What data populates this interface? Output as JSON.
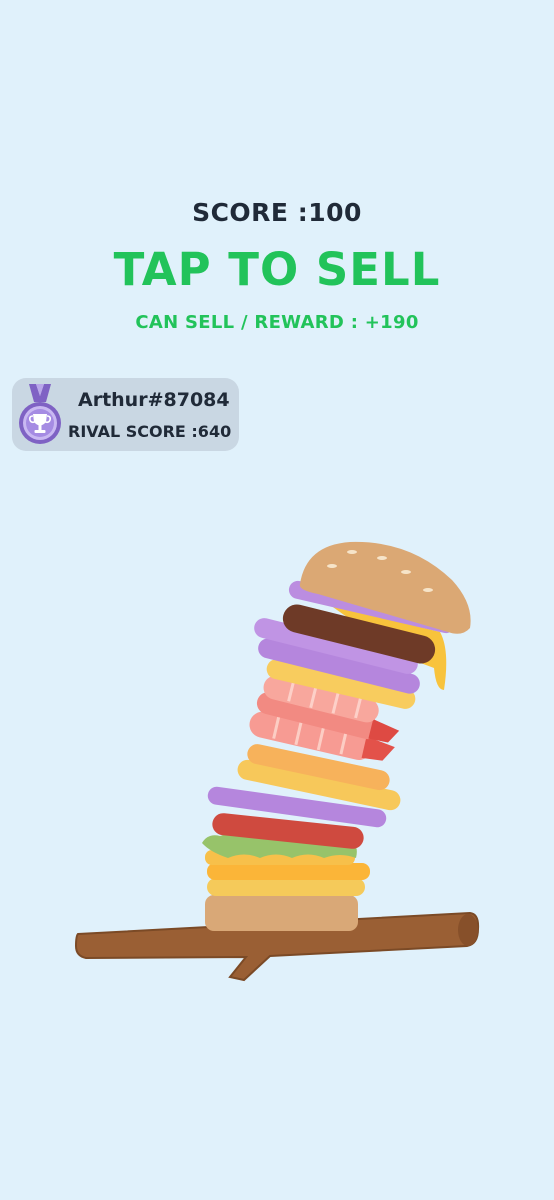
{
  "hud": {
    "score_label": "SCORE :100",
    "primary_action": "TAP TO SELL",
    "reward_label": "CAN SELL / REWARD : +190"
  },
  "rival": {
    "name": "Arthur#87084",
    "score_label": "RIVAL SCORE :640",
    "medal_icon": "trophy-medal-icon"
  },
  "colors": {
    "background": "#e0f1fb",
    "accent_green": "#22c35a",
    "text_dark": "#202a38",
    "card_bg": "#c9d7e3",
    "medal_purple": "#9a7fd6"
  },
  "burger_stack": {
    "layers_bottom_to_top": [
      "bottom-bun",
      "cheese",
      "cheese",
      "cheese",
      "lettuce",
      "bacon",
      "onion",
      "cheese",
      "cheese",
      "shrimp",
      "shrimp",
      "shrimp",
      "cheese",
      "onion",
      "onion",
      "cheese",
      "patty",
      "onion",
      "top-bun"
    ]
  }
}
